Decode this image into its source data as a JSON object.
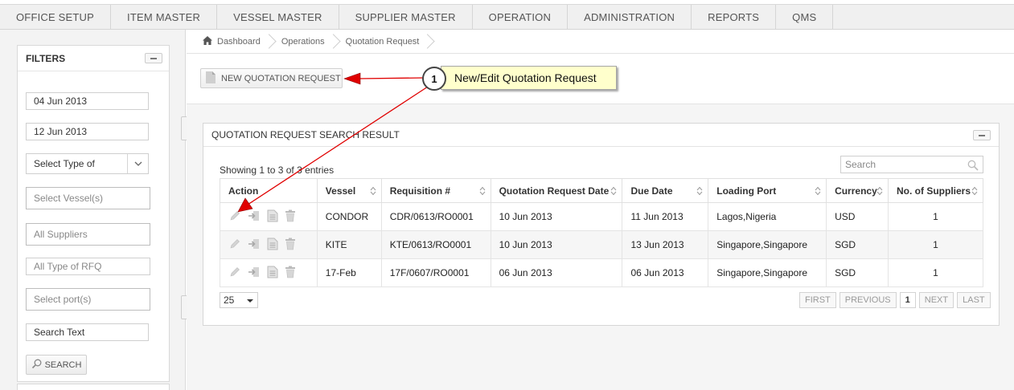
{
  "nav": {
    "items": [
      "OFFICE SETUP",
      "ITEM MASTER",
      "VESSEL MASTER",
      "SUPPLIER MASTER",
      "OPERATION",
      "ADMINISTRATION",
      "REPORTS",
      "QMS"
    ]
  },
  "breadcrumb": {
    "items": [
      "Dashboard",
      "Operations",
      "Quotation Request"
    ]
  },
  "filters": {
    "title": "FILTERS",
    "date_from": "04 Jun 2013",
    "date_to": "12 Jun 2013",
    "type_select": "Select Type of",
    "vessels_placeholder": "Select Vessel(s)",
    "suppliers_placeholder": "All Suppliers",
    "rfq_placeholder": "All Type of RFQ",
    "ports_placeholder": "Select port(s)",
    "search_text_placeholder": "Search Text",
    "search_button": "SEARCH"
  },
  "toolbar": {
    "new_button": "NEW QUOTATION REQUEST"
  },
  "callout": {
    "number": "1",
    "text": "New/Edit Quotation Request",
    "arrow_color": "#e00000"
  },
  "panel": {
    "title": "QUOTATION REQUEST SEARCH RESULT",
    "showing": "Showing 1 to 3 of 3 entries",
    "search_placeholder": "Search",
    "columns": [
      "Action",
      "Vessel",
      "Requisition #",
      "Quotation Request Date",
      "Due Date",
      "Loading Port",
      "Currency",
      "No. of Suppliers"
    ],
    "rows": [
      {
        "vessel": "CONDOR",
        "requisition": "CDR/0613/RO0001",
        "request_date": "10 Jun 2013",
        "due_date": "11 Jun 2013",
        "port": "Lagos,Nigeria",
        "currency": "USD",
        "suppliers": "1"
      },
      {
        "vessel": "KITE",
        "requisition": "KTE/0613/RO0001",
        "request_date": "10 Jun 2013",
        "due_date": "13 Jun 2013",
        "port": "Singapore,Singapore",
        "currency": "SGD",
        "suppliers": "1"
      },
      {
        "vessel": "17-Feb",
        "requisition": "17F/0607/RO0001",
        "request_date": "06 Jun 2013",
        "due_date": "06 Jun 2013",
        "port": "Singapore,Singapore",
        "currency": "SGD",
        "suppliers": "1"
      }
    ],
    "page_size": "25",
    "pager": {
      "first": "FIRST",
      "previous": "PREVIOUS",
      "current": "1",
      "next": "NEXT",
      "last": "LAST"
    }
  }
}
